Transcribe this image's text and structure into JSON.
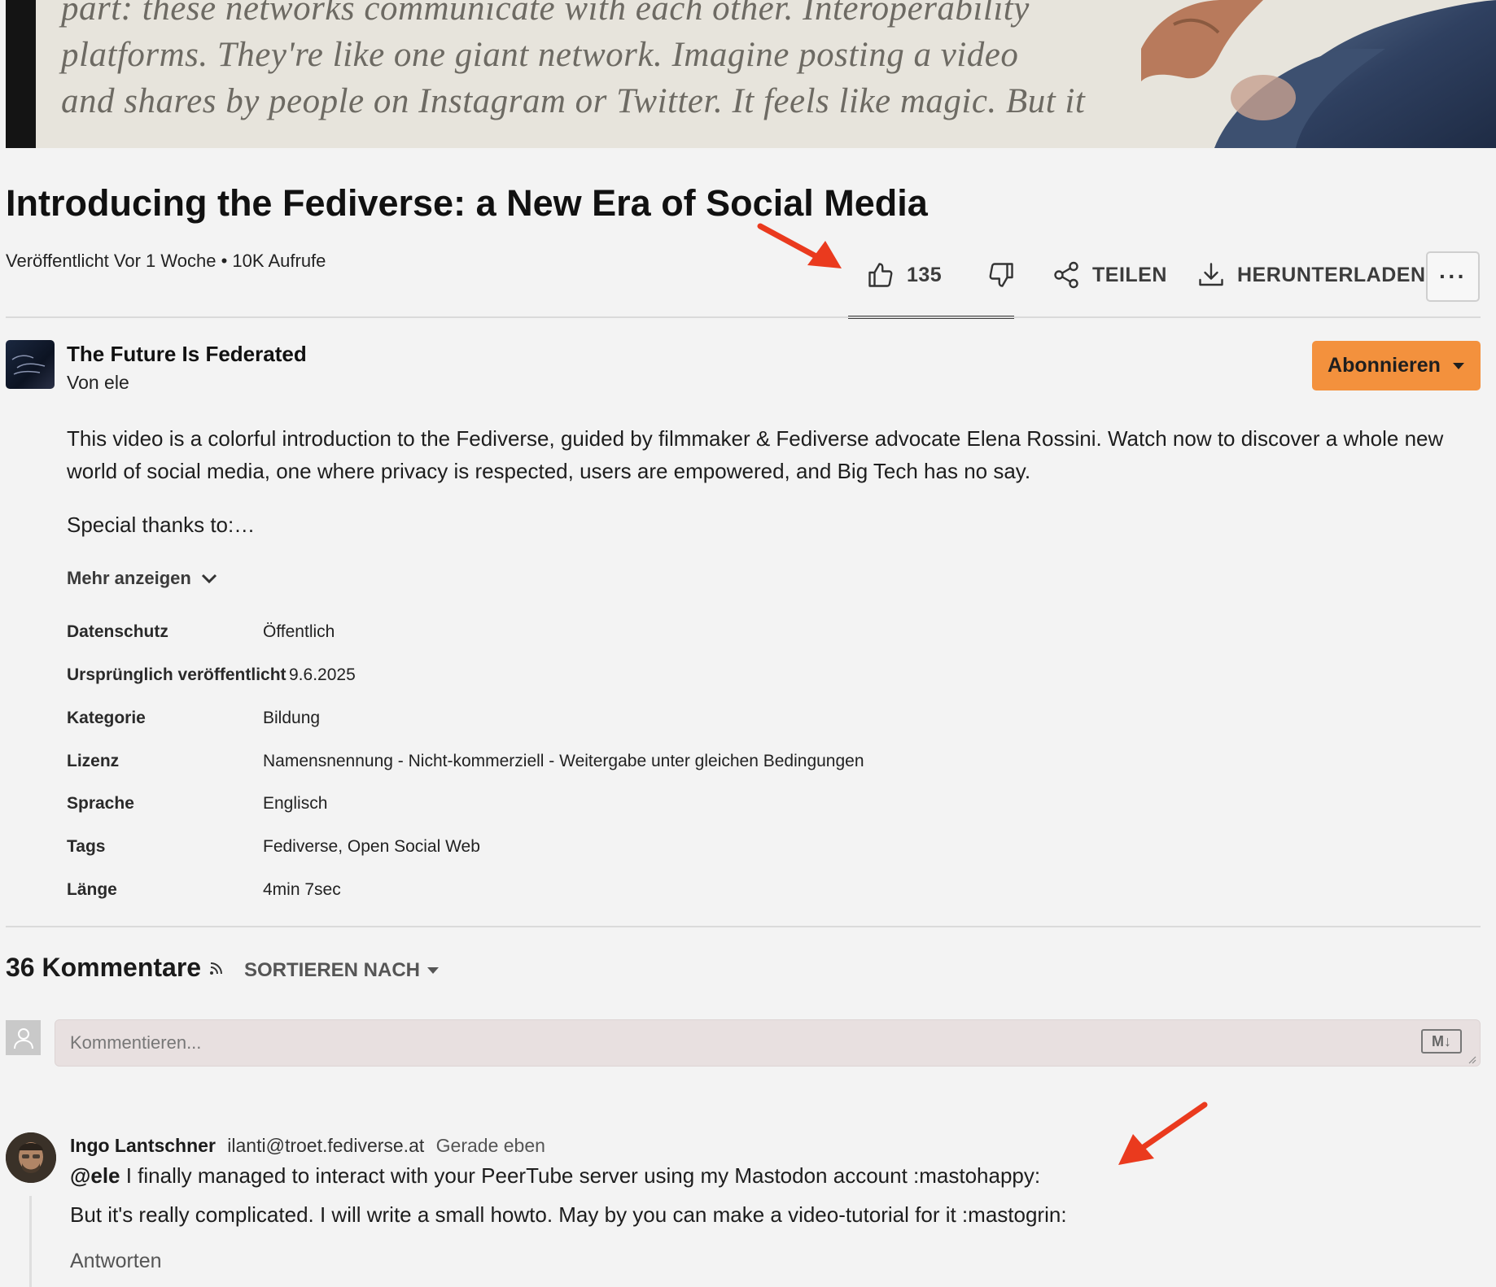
{
  "player": {
    "background_text": [
      "part: these networks communicate with each other. Interoperability",
      "platforms. They're like one giant network. Imagine posting a video",
      "and shares by people on Instagram or Twitter. It feels like magic. But it"
    ]
  },
  "video": {
    "title": "Introducing the Fediverse: a New Era of Social Media",
    "published": "Veröffentlicht Vor 1 Woche",
    "bullet": "•",
    "views": "10K Aufrufe",
    "likes": "135",
    "share_label": "TEILEN",
    "download_label": "HERUNTERLADEN",
    "more_label": "···"
  },
  "channel": {
    "name": "The Future Is Federated",
    "by": "Von ele",
    "subscribe_label": "Abonnieren"
  },
  "description": {
    "text": "This video is a colorful introduction to the Fediverse, guided by filmmaker & Fediverse advocate Elena Rossini. Watch now to discover a whole new world of social media, one where privacy is respected, users are empowered, and Big Tech has no say.",
    "thanks": "Special thanks to:…",
    "show_more": "Mehr anzeigen"
  },
  "metadata": {
    "privacy_label": "Datenschutz",
    "privacy_value": "Öffentlich",
    "origin_label": "Ursprünglich veröffentlicht",
    "origin_value": "9.6.2025",
    "category_label": "Kategorie",
    "category_value": "Bildung",
    "license_label": "Lizenz",
    "license_value": "Namensnennung - Nicht-kommerziell - Weitergabe unter gleichen Bedingungen",
    "language_label": "Sprache",
    "language_value": "Englisch",
    "tags_label": "Tags",
    "tags_value": "Fediverse, Open Social Web",
    "duration_label": "Länge",
    "duration_value": "4min 7sec"
  },
  "comments": {
    "count_label": "36 Kommentare",
    "sort_label": "SORTIEREN NACH",
    "input_placeholder": "Kommentieren...",
    "markdown_badge": "M↓",
    "items": [
      {
        "author": "Ingo Lantschner",
        "handle": "ilanti@troet.fediverse.at",
        "time": "Gerade eben",
        "mention": "@ele",
        "line1_rest": " I finally managed to interact with your PeerTube server using my Mastodon account :mastohappy:",
        "line2": "But it's really complicated. I will write a small howto. May by you can make a video-tutorial for it :mastogrin:",
        "reply_label": "Antworten"
      }
    ]
  },
  "colors": {
    "accent_orange": "#f3913d",
    "annotation_arrow": "#ea3a1e",
    "background": "#f3f3f3"
  }
}
